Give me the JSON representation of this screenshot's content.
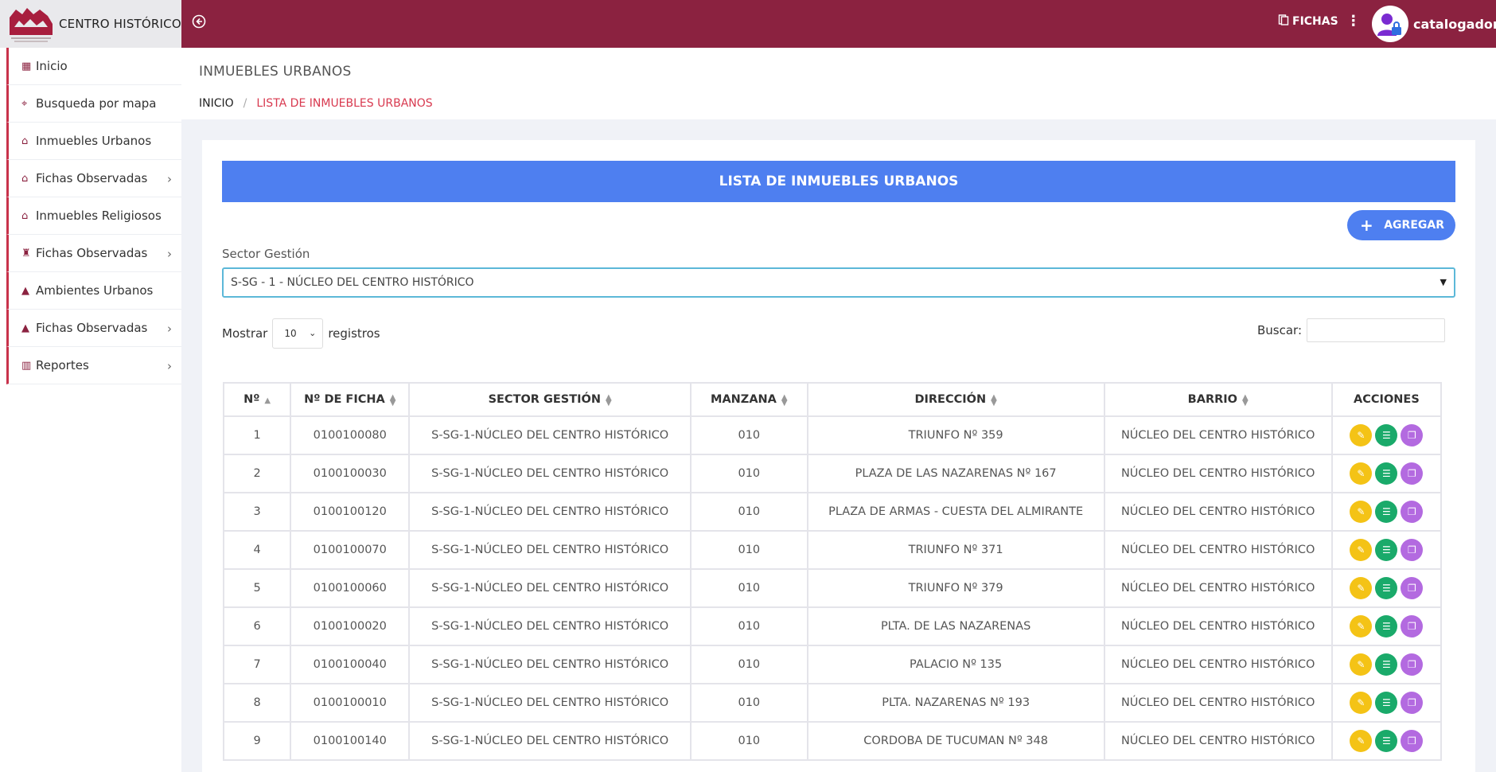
{
  "brand": {
    "title": "CENTRO HISTÓRICO"
  },
  "topbar": {
    "fichas_label": "FICHAS",
    "username": "catalogador"
  },
  "sidebar": {
    "items": [
      {
        "label": "Inicio",
        "icon": "grid-icon",
        "glyph": "▦",
        "chevron": false
      },
      {
        "label": "Busqueda por mapa",
        "icon": "map-pin-icon",
        "glyph": "⌖",
        "chevron": false
      },
      {
        "label": "Inmuebles Urbanos",
        "icon": "home-icon",
        "glyph": "⌂",
        "chevron": false
      },
      {
        "label": "Fichas Observadas",
        "icon": "home-icon",
        "glyph": "⌂",
        "chevron": true
      },
      {
        "label": "Inmuebles Religiosos",
        "icon": "home-icon",
        "glyph": "⌂",
        "chevron": false
      },
      {
        "label": "Fichas Observadas",
        "icon": "church-icon",
        "glyph": "♜",
        "chevron": true
      },
      {
        "label": "Ambientes Urbanos",
        "icon": "road-icon",
        "glyph": "▲",
        "chevron": false
      },
      {
        "label": "Fichas Observadas",
        "icon": "road-icon",
        "glyph": "▲",
        "chevron": true
      },
      {
        "label": "Reportes",
        "icon": "bar-chart-icon",
        "glyph": "▥",
        "chevron": true
      }
    ]
  },
  "header": {
    "title": "INMUEBLES URBANOS",
    "breadcrumb_home": "INICIO",
    "breadcrumb_sep": "/",
    "breadcrumb_active": "LISTA DE INMUEBLES URBANOS"
  },
  "card": {
    "title": "LISTA DE INMUEBLES URBANOS",
    "add_label": "AGREGAR",
    "sector_label": "Sector Gestión",
    "sector_value": "S-SG - 1 - NÚCLEO DEL CENTRO HISTÓRICO",
    "show_label": "Mostrar",
    "show_value": "10",
    "records_label": "registros",
    "search_label": "Buscar:"
  },
  "table": {
    "headers": [
      "Nº",
      "Nº DE FICHA",
      "SECTOR GESTIÓN",
      "MANZANA",
      "DIRECCIÓN",
      "BARRIO",
      "ACCIONES"
    ],
    "rows": [
      [
        "1",
        "0100100080",
        "S-SG-1-NÚCLEO DEL CENTRO HISTÓRICO",
        "010",
        "TRIUNFO Nº 359",
        "NÚCLEO DEL CENTRO HISTÓRICO"
      ],
      [
        "2",
        "0100100030",
        "S-SG-1-NÚCLEO DEL CENTRO HISTÓRICO",
        "010",
        "PLAZA DE LAS NAZARENAS Nº 167",
        "NÚCLEO DEL CENTRO HISTÓRICO"
      ],
      [
        "3",
        "0100100120",
        "S-SG-1-NÚCLEO DEL CENTRO HISTÓRICO",
        "010",
        "PLAZA DE ARMAS - CUESTA DEL ALMIRANTE",
        "NÚCLEO DEL CENTRO HISTÓRICO"
      ],
      [
        "4",
        "0100100070",
        "S-SG-1-NÚCLEO DEL CENTRO HISTÓRICO",
        "010",
        "TRIUNFO Nº 371",
        "NÚCLEO DEL CENTRO HISTÓRICO"
      ],
      [
        "5",
        "0100100060",
        "S-SG-1-NÚCLEO DEL CENTRO HISTÓRICO",
        "010",
        "TRIUNFO Nº 379",
        "NÚCLEO DEL CENTRO HISTÓRICO"
      ],
      [
        "6",
        "0100100020",
        "S-SG-1-NÚCLEO DEL CENTRO HISTÓRICO",
        "010",
        "PLTA. DE LAS NAZARENAS",
        "NÚCLEO DEL CENTRO HISTÓRICO"
      ],
      [
        "7",
        "0100100040",
        "S-SG-1-NÚCLEO DEL CENTRO HISTÓRICO",
        "010",
        "PALACIO Nº 135",
        "NÚCLEO DEL CENTRO HISTÓRICO"
      ],
      [
        "8",
        "0100100010",
        "S-SG-1-NÚCLEO DEL CENTRO HISTÓRICO",
        "010",
        "PLTA. NAZARENAS Nº 193",
        "NÚCLEO DEL CENTRO HISTÓRICO"
      ],
      [
        "9",
        "0100100140",
        "S-SG-1-NÚCLEO DEL CENTRO HISTÓRICO",
        "010",
        "CORDOBA DE TUCUMAN Nº 348",
        "NÚCLEO DEL CENTRO HISTÓRICO"
      ]
    ]
  }
}
